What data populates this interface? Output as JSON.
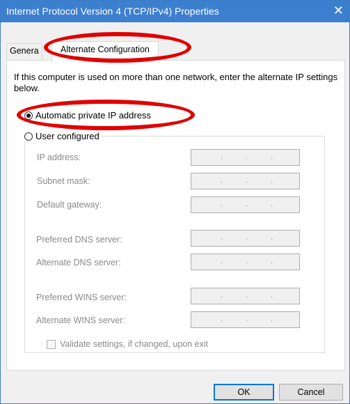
{
  "window": {
    "title": "Internet Protocol Version 4 (TCP/IPv4) Properties",
    "close_glyph": "✕"
  },
  "tabs": {
    "general": "Genera",
    "alternate": "Alternate Configuration"
  },
  "description": "If this computer is used on more than one network, enter the alternate IP settings below.",
  "options": {
    "automatic": "Automatic private IP address",
    "user": "User configured",
    "selected": "automatic"
  },
  "fields": [
    {
      "label": "IP address:"
    },
    {
      "label": "Subnet mask:"
    },
    {
      "label": "Default gateway:"
    },
    {
      "label": "Preferred DNS server:"
    },
    {
      "label": "Alternate DNS server:"
    },
    {
      "label": "Preferred WINS server:"
    },
    {
      "label": "Alternate WINS server:"
    }
  ],
  "ip_dots": ".",
  "validate": {
    "label": "Validate settings, if changed, upon exit",
    "checked": false
  },
  "buttons": {
    "ok": "OK",
    "cancel": "Cancel"
  },
  "colors": {
    "titlebar": "#3d7fcf",
    "annotation": "#e10000",
    "ok_border": "#0078d7"
  }
}
